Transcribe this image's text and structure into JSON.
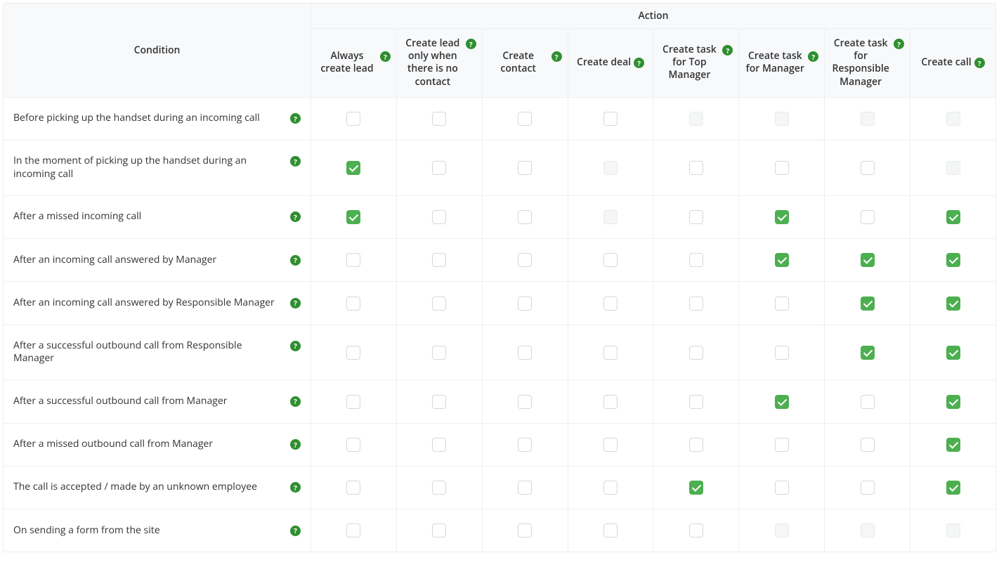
{
  "headers": {
    "condition": "Condition",
    "action_group": "Action",
    "columns": [
      "Always create lead",
      "Create lead only when there is no contact",
      "Create contact",
      "Create deal",
      "Create task for Top Manager",
      "Create task for Manager",
      "Create task for Responsible Manager",
      "Create call"
    ]
  },
  "rows": [
    {
      "label": "Before picking up the handset during an incoming call",
      "cells": [
        "u",
        "u",
        "u",
        "u",
        "d",
        "d",
        "d",
        "d"
      ]
    },
    {
      "label": "In the moment of picking up the handset during an incoming call",
      "cells": [
        "c",
        "u",
        "u",
        "d",
        "u",
        "u",
        "u",
        "d"
      ]
    },
    {
      "label": "After a missed incoming call",
      "cells": [
        "c",
        "u",
        "u",
        "d",
        "u",
        "c",
        "u",
        "c"
      ]
    },
    {
      "label": "After an incoming call answered by Manager",
      "cells": [
        "u",
        "u",
        "u",
        "u",
        "u",
        "c",
        "c",
        "c"
      ]
    },
    {
      "label": "After an incoming call answered by Responsible Manager",
      "cells": [
        "u",
        "u",
        "u",
        "u",
        "u",
        "u",
        "c",
        "c"
      ]
    },
    {
      "label": "After a successful outbound call from Responsible Manager",
      "cells": [
        "u",
        "u",
        "u",
        "u",
        "u",
        "u",
        "c",
        "c"
      ]
    },
    {
      "label": "After a successful outbound call from Manager",
      "cells": [
        "u",
        "u",
        "u",
        "u",
        "u",
        "c",
        "u",
        "c"
      ]
    },
    {
      "label": "After a missed outbound call from Manager",
      "cells": [
        "u",
        "u",
        "u",
        "u",
        "u",
        "u",
        "u",
        "c"
      ]
    },
    {
      "label": "The call is accepted / made by an unknown employee",
      "cells": [
        "u",
        "u",
        "u",
        "u",
        "c",
        "u",
        "u",
        "c"
      ]
    },
    {
      "label": "On sending a form from the site",
      "cells": [
        "u",
        "u",
        "u",
        "u",
        "u",
        "d",
        "d",
        "d"
      ]
    }
  ]
}
